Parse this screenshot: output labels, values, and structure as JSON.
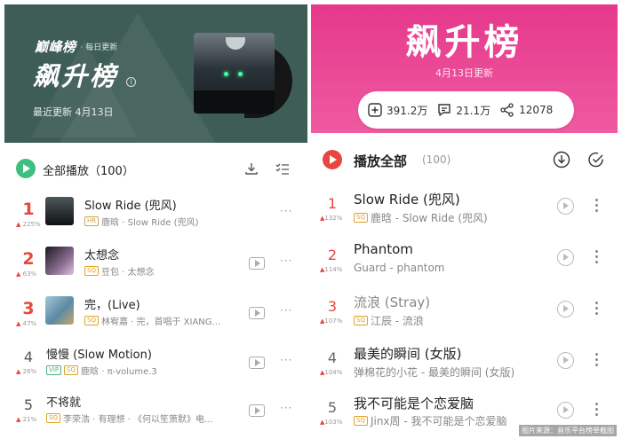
{
  "left": {
    "brand": "巅峰榜",
    "brand_sub": "· 每日更新",
    "title": "飙升榜",
    "info": "i",
    "updated": "最近更新 4月13日",
    "play_all": "全部播放（100）",
    "songs": [
      {
        "rank": "1",
        "change": "225%",
        "title": "Slow Ride (兜风)",
        "tag": "HR",
        "sub": "鹿晗 · Slow Ride (兜风)"
      },
      {
        "rank": "2",
        "change": "63%",
        "title": "太想念",
        "tag": "SQ",
        "sub": "豆包 · 太想念"
      },
      {
        "rank": "3",
        "change": "47%",
        "title": "完，(Live)",
        "tag": "SQ",
        "sub": "林宥嘉 · 完，首唱于 XIANG..."
      },
      {
        "rank": "4",
        "change": "26%",
        "title": "慢慢 (Slow Motion)",
        "tag": "VIP",
        "tag2": "SQ",
        "sub": "鹿晗 · π-volume.3"
      },
      {
        "rank": "5",
        "change": "21%",
        "title": "不将就",
        "tag": "SQ",
        "sub": "李荣浩 · 有理想 · 《何以笙箫默》电..."
      }
    ],
    "more": "···"
  },
  "right": {
    "title": "飙升榜",
    "updated": "4月13日更新",
    "stats": {
      "favorites": "391.2万",
      "comments": "21.1万",
      "shares": "12078"
    },
    "play_all": "播放全部",
    "count": "(100)",
    "songs": [
      {
        "rank": "1",
        "change": "132%",
        "title": "Slow Ride (兜风)",
        "tag": "SQ",
        "sub": "鹿晗 - Slow Ride (兜风)"
      },
      {
        "rank": "2",
        "change": "114%",
        "title": "Phantom",
        "tag": "",
        "sub": "Guard - phantom"
      },
      {
        "rank": "3",
        "change": "107%",
        "title": "流浪 (Stray)",
        "tag": "SQ",
        "sub": "江辰 - 流浪"
      },
      {
        "rank": "4",
        "change": "104%",
        "title": "最美的瞬间 (女版)",
        "tag": "",
        "sub": "弹棉花的小花 - 最美的瞬间 (女版)"
      },
      {
        "rank": "5",
        "change": "103%",
        "title": "我不可能是个恋爱脑",
        "tag": "SQ",
        "sub": "Jinx周 - 我不可能是个恋爱脑"
      }
    ]
  },
  "watermark": "图片来源：音乐平台榜单截图",
  "colors": {
    "left_header": "#3f5d57",
    "right_header": "#e6388c",
    "rank_red": "#e8463f",
    "play_green": "#3fbf7f"
  }
}
